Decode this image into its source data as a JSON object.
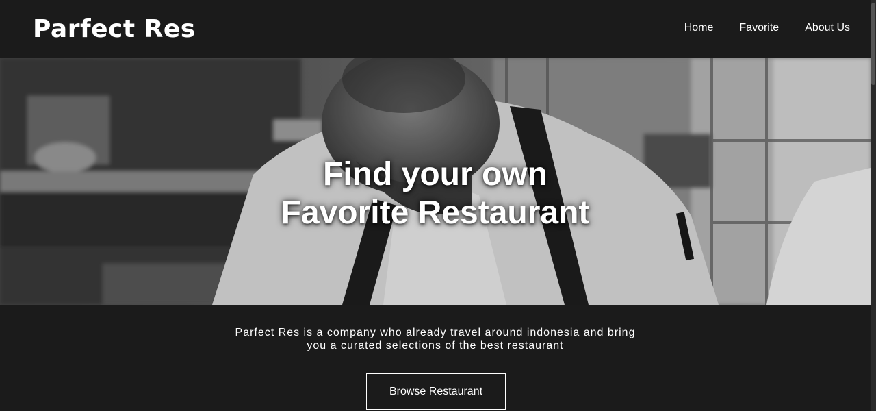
{
  "header": {
    "logo": "Parfect Res",
    "nav": [
      "Home",
      "Favorite",
      "About Us"
    ]
  },
  "hero": {
    "title_line1": "Find your own",
    "title_line2": "Favorite Restaurant",
    "image": "chef-in-kitchen-photo"
  },
  "description": {
    "line1": "Parfect Res is a company who already travel around indonesia and bring",
    "line2": "you a curated selections of the best restaurant"
  },
  "cta": {
    "label": "Browse Restaurant"
  },
  "colors": {
    "background": "#1b1b1b",
    "text": "#ffffff"
  }
}
